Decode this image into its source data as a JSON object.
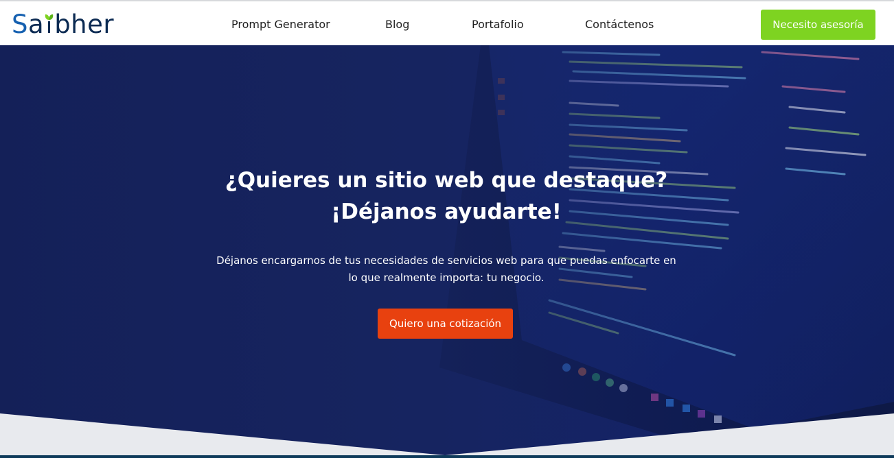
{
  "brand": {
    "name": "Saibher",
    "logo_prefix": "S",
    "logo_middle": "a",
    "logo_suffix": "bher"
  },
  "nav": {
    "links": [
      "Prompt Generator",
      "Blog",
      "Portafolio",
      "Contáctenos"
    ],
    "cta": "Necesito asesoría"
  },
  "hero": {
    "title_line1": "¿Quieres un sitio web que destaque?",
    "title_line2": "¡Déjanos ayudarte!",
    "subtitle_line1": "Déjanos encargarnos de tus necesidades de servicios web para que puedas enfocarte en",
    "subtitle_line2": "lo que realmente importa: tu negocio.",
    "cta": "Quiero una cotización"
  },
  "colors": {
    "brand_dark": "#0b2a52",
    "brand_blue": "#1560b0",
    "brand_green": "#7ed321",
    "cta_orange": "#e8410f",
    "hero_blue": "#1b2a66"
  }
}
